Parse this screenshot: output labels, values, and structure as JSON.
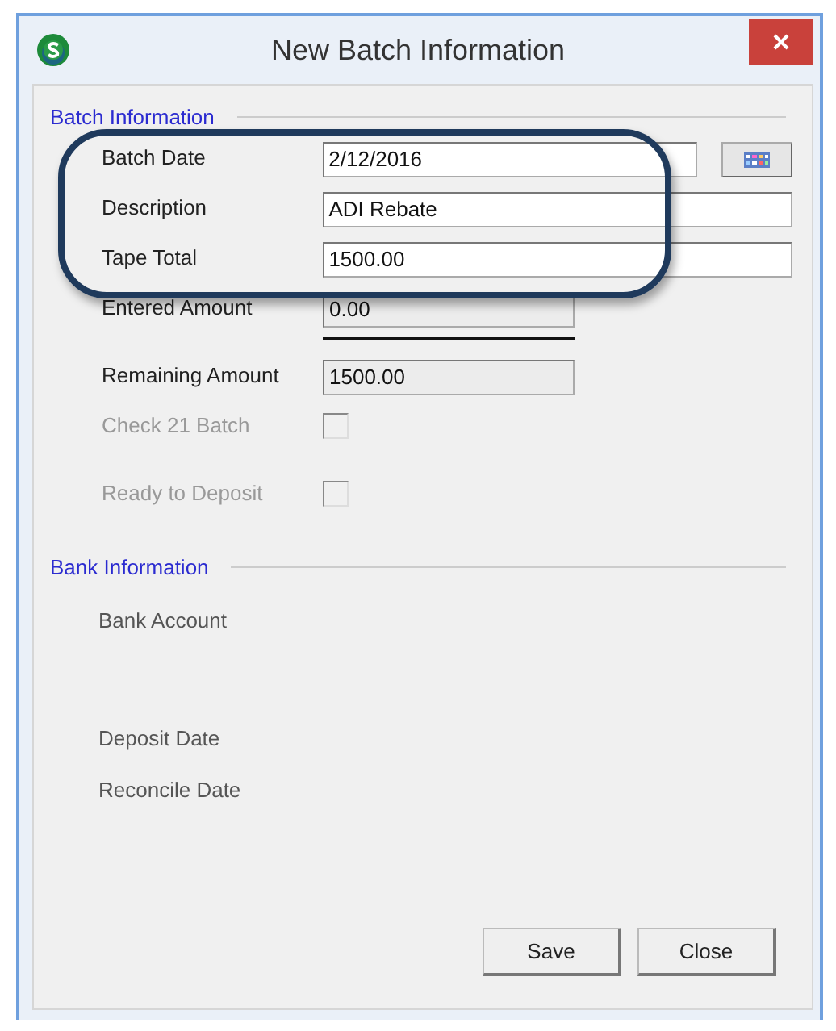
{
  "window": {
    "title": "New Batch Information"
  },
  "batch_section": {
    "title": "Batch Information",
    "fields": [
      {
        "label": "Batch Date",
        "value": "2/12/2016",
        "kind": "date",
        "readonly": false,
        "rule_below": false
      },
      {
        "label": "Description",
        "value": "ADI Rebate",
        "kind": "text",
        "readonly": false,
        "rule_below": false
      },
      {
        "label": "Tape Total",
        "value": "1500.00",
        "kind": "text",
        "readonly": false,
        "rule_below": false
      },
      {
        "label": "Entered Amount",
        "value": "0.00",
        "kind": "amount",
        "readonly": true,
        "rule_below": true
      },
      {
        "label": "Remaining Amount",
        "value": "1500.00",
        "kind": "amount",
        "readonly": true,
        "rule_below": false
      }
    ],
    "checkboxes": [
      {
        "label": "Check 21 Batch",
        "checked": false,
        "disabled": true
      },
      {
        "label": "Ready to Deposit",
        "checked": false,
        "disabled": true
      }
    ]
  },
  "bank_section": {
    "title": "Bank Information",
    "labels": [
      "Bank Account",
      "Deposit Date",
      "Reconcile Date"
    ]
  },
  "buttons": [
    "Save",
    "Close"
  ]
}
